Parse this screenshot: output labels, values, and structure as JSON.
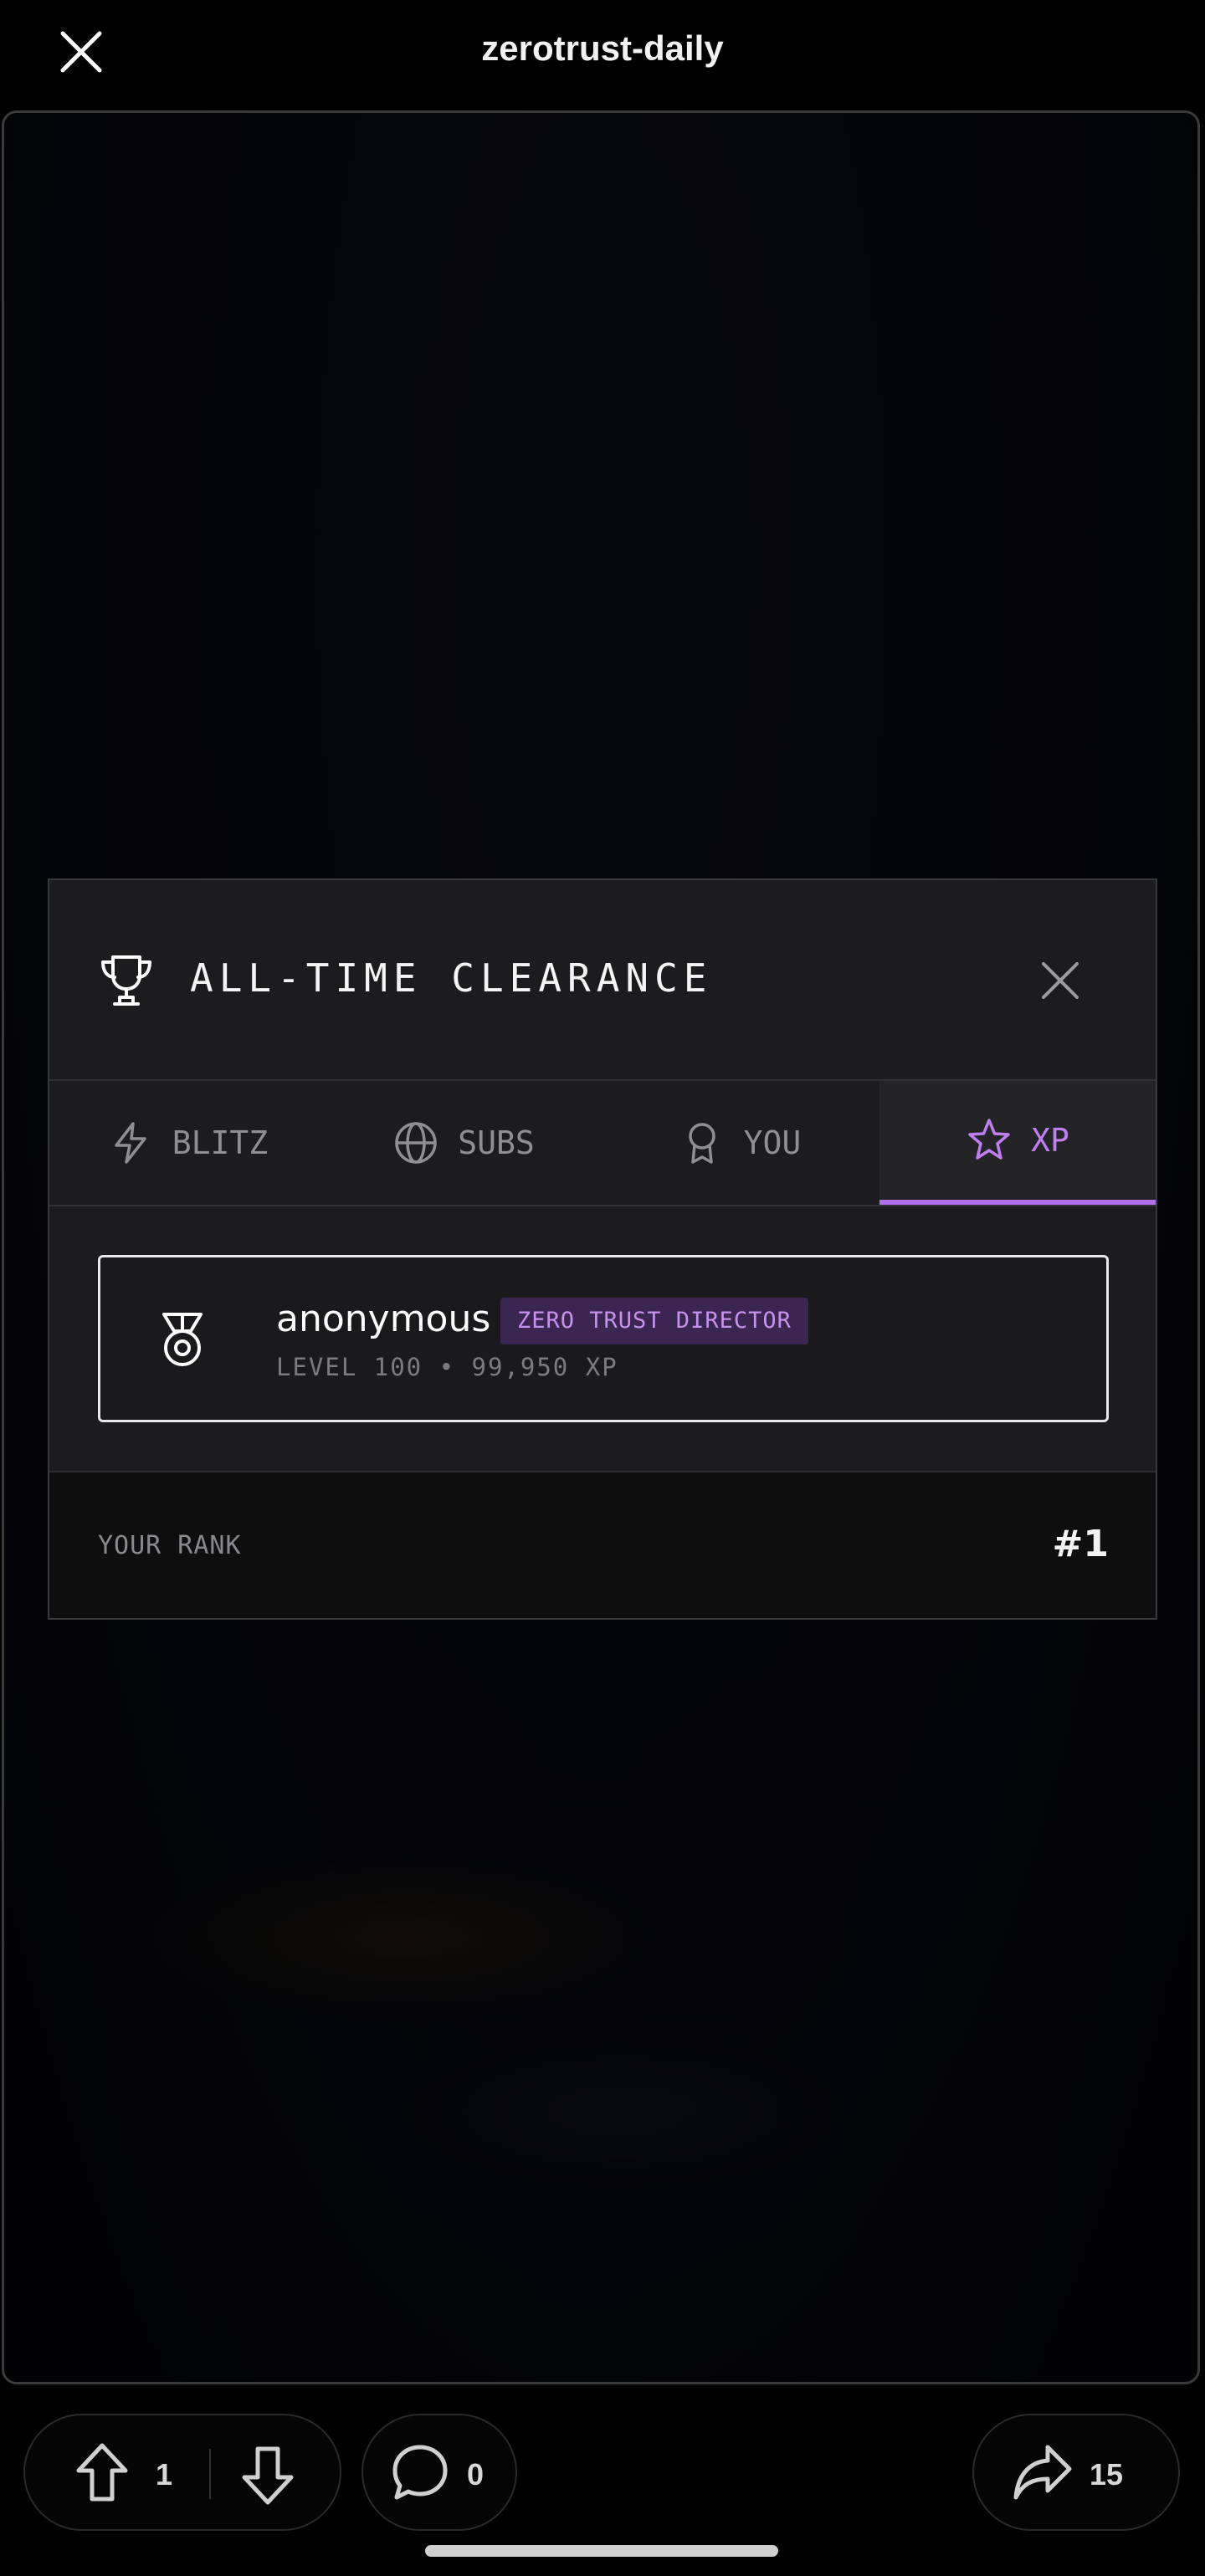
{
  "header": {
    "title": "zerotrust-daily",
    "close_icon": "close-icon"
  },
  "modal": {
    "title": "ALL-TIME CLEARANCE",
    "title_icon": "trophy-icon",
    "close_icon": "close-icon",
    "tabs": [
      {
        "label": "BLITZ",
        "icon": "lightning-icon",
        "active": false
      },
      {
        "label": "SUBS",
        "icon": "globe-icon",
        "active": false
      },
      {
        "label": "YOU",
        "icon": "award-ribbon-icon",
        "active": false
      },
      {
        "label": "XP",
        "icon": "star-icon",
        "active": true
      }
    ],
    "entry": {
      "icon": "medal-icon",
      "name": "anonymous",
      "badge": "ZERO TRUST DIRECTOR",
      "subtitle": "LEVEL 100 • 99,950 XP"
    },
    "rank": {
      "label": "YOUR RANK",
      "value": "#1"
    }
  },
  "actions": {
    "upvote_count": "1",
    "comment_count": "0",
    "share_count": "15"
  },
  "colors": {
    "accent": "#b06fe8",
    "badge_bg": "#3a2650",
    "modal_bg": "#1c1c1e"
  }
}
